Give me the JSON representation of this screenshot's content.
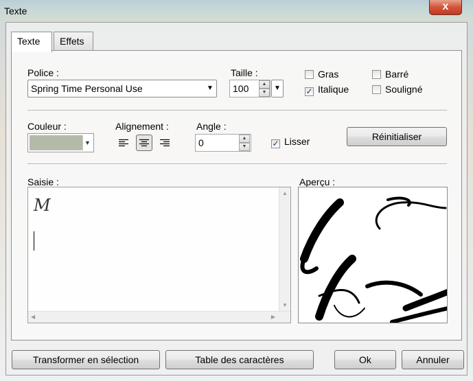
{
  "window": {
    "title": "Texte",
    "close_glyph": "x"
  },
  "tabs": [
    {
      "label": "Texte",
      "active": true
    },
    {
      "label": "Effets",
      "active": false
    }
  ],
  "font": {
    "label": "Police :",
    "value": "Spring Time Personal Use",
    "size_label": "Taille :",
    "size_value": "100"
  },
  "styles": {
    "bold": {
      "label": "Gras",
      "checked": false
    },
    "italic": {
      "label": "Italique",
      "checked": true
    },
    "strike": {
      "label": "Barré",
      "checked": false
    },
    "underline": {
      "label": "Souligné",
      "checked": false
    }
  },
  "color": {
    "label": "Couleur :",
    "value": "#b3bba8"
  },
  "alignment": {
    "label": "Alignement :",
    "selected": "center",
    "options": [
      "left",
      "center",
      "right"
    ]
  },
  "angle": {
    "label": "Angle :",
    "value": "0"
  },
  "smooth": {
    "label": "Lisser",
    "checked": true
  },
  "reset_button": "Réinitialiser",
  "input": {
    "label": "Saisie :",
    "text": "M"
  },
  "preview": {
    "label": "Aperçu :"
  },
  "footer": {
    "to_selection": "Transformer en sélection",
    "char_table": "Table des caractères",
    "ok": "Ok",
    "cancel": "Annuler"
  },
  "icons": [
    "close-icon",
    "dropdown-arrow-icon",
    "spin-up-icon",
    "spin-down-icon",
    "align-left-icon",
    "align-center-icon",
    "align-right-icon",
    "check-icon"
  ]
}
